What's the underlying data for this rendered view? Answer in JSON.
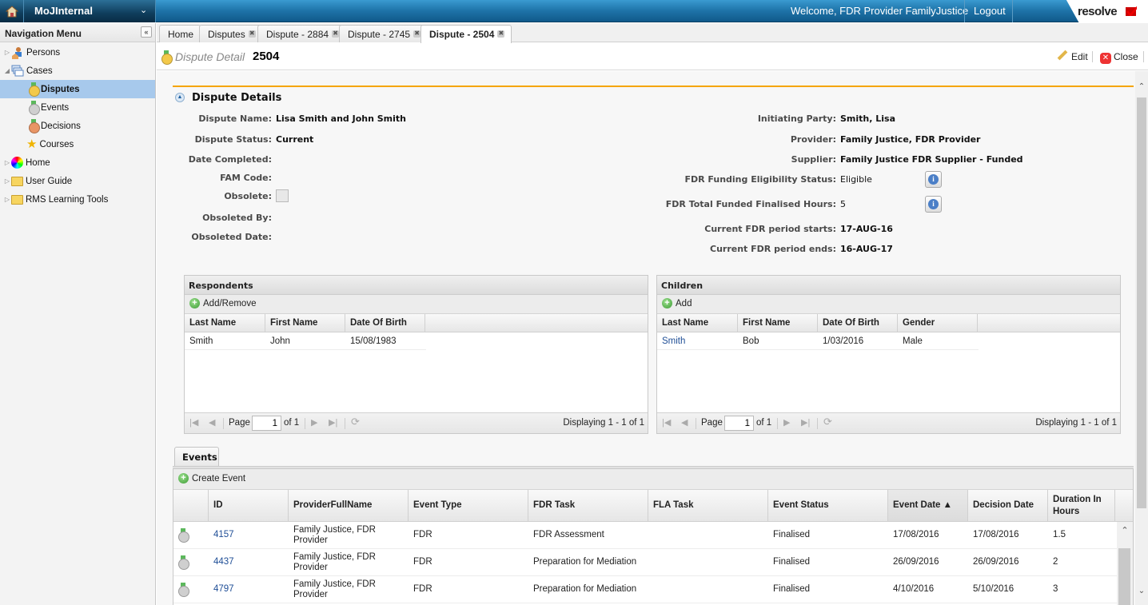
{
  "app": {
    "name": "MoJInternal",
    "welcome": "Welcome, FDR Provider FamilyJustice",
    "logout": "Logout",
    "logo": "resolve"
  },
  "sidebar": {
    "title": "Navigation Menu",
    "collapse": "«",
    "items": [
      {
        "label": "Persons",
        "icon": "persons-icon"
      },
      {
        "label": "Cases",
        "icon": "cases-icon"
      },
      {
        "label": "Disputes",
        "icon": "dispute-medal-icon",
        "selected": true
      },
      {
        "label": "Events",
        "icon": "event-medal-icon"
      },
      {
        "label": "Decisions",
        "icon": "decision-medal-icon"
      },
      {
        "label": "Courses",
        "icon": "star-icon"
      },
      {
        "label": "Home",
        "icon": "color-wheel-icon"
      },
      {
        "label": "User Guide",
        "icon": "folder-icon"
      },
      {
        "label": "RMS Learning Tools",
        "icon": "folder-icon"
      }
    ]
  },
  "tabs": [
    {
      "label": "Home",
      "closable": false
    },
    {
      "label": "Disputes",
      "closable": true
    },
    {
      "label": "Dispute - 2884",
      "closable": true
    },
    {
      "label": "Dispute - 2745",
      "closable": true
    },
    {
      "label": "Dispute - 2504",
      "closable": true,
      "active": true
    }
  ],
  "title": {
    "label": "Dispute Detail",
    "number": "2504",
    "edit": "Edit",
    "close": "Close"
  },
  "details": {
    "section_title": "Dispute Details",
    "left": [
      {
        "label": "Dispute Name:",
        "value": "Lisa Smith and John Smith"
      },
      {
        "label": "Dispute Status:",
        "value": "Current"
      },
      {
        "label": "Date Completed:",
        "value": ""
      },
      {
        "label": "FAM Code:",
        "value": ""
      },
      {
        "label": "Obsolete:",
        "value": false
      },
      {
        "label": "Obsoleted By:",
        "value": ""
      },
      {
        "label": "Obsoleted Date:",
        "value": ""
      }
    ],
    "right": [
      {
        "label": "Initiating Party:",
        "value": "Smith, Lisa"
      },
      {
        "label": "Provider:",
        "value": "Family Justice, FDR Provider"
      },
      {
        "label": "Supplier:",
        "value": "Family Justice FDR Supplier - Funded"
      },
      {
        "label": "FDR Funding Eligibility Status:",
        "value": "Eligible"
      },
      {
        "label": "FDR Total Funded Finalised Hours:",
        "value": "5"
      },
      {
        "label": "Current FDR period starts:",
        "value": "17-AUG-16"
      },
      {
        "label": "Current FDR period ends:",
        "value": "16-AUG-17"
      }
    ]
  },
  "respondents": {
    "title": "Respondents",
    "action": "Add/Remove",
    "columns": [
      "Last Name",
      "First Name",
      "Date Of Birth"
    ],
    "rows": [
      [
        "Smith",
        "John",
        "15/08/1983"
      ]
    ],
    "pager": {
      "page_label": "Page",
      "page": "1",
      "of": "of 1",
      "display": "Displaying 1 - 1 of 1"
    }
  },
  "children": {
    "title": "Children",
    "action": "Add",
    "columns": [
      "Last Name",
      "First Name",
      "Date Of Birth",
      "Gender"
    ],
    "rows": [
      [
        "Smith",
        "Bob",
        "1/03/2016",
        "Male"
      ]
    ],
    "pager": {
      "page_label": "Page",
      "page": "1",
      "of": "of 1",
      "display": "Displaying 1 - 1 of 1"
    }
  },
  "events": {
    "tab": "Events",
    "action": "Create Event",
    "columns": [
      "",
      "ID",
      "ProviderFullName",
      "Event Type",
      "FDR Task",
      "FLA Task",
      "Event Status",
      "Event Date ▲",
      "Decision Date",
      "Duration In Hours"
    ],
    "rows": [
      [
        "",
        "4157",
        "Family Justice, FDR Provider",
        "FDR",
        "FDR Assessment",
        "",
        "Finalised",
        "17/08/2016",
        "17/08/2016",
        "1.5"
      ],
      [
        "",
        "4437",
        "Family Justice, FDR Provider",
        "FDR",
        "Preparation for Mediation",
        "",
        "Finalised",
        "26/09/2016",
        "26/09/2016",
        "2"
      ],
      [
        "",
        "4797",
        "Family Justice, FDR Provider",
        "FDR",
        "Preparation for Mediation",
        "",
        "Finalised",
        "4/10/2016",
        "5/10/2016",
        "3"
      ]
    ]
  },
  "colors": {
    "accent_orange": "#f5a500",
    "header_blue": "#1e73a8",
    "selected_nav": "#a7c9ec",
    "link": "#1f4e96"
  }
}
